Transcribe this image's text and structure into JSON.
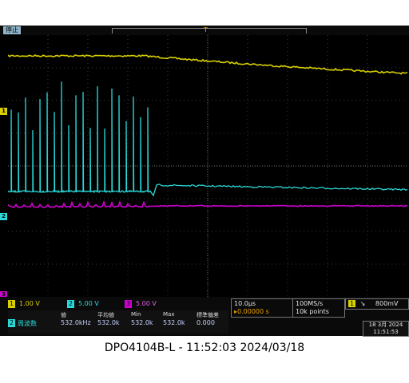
{
  "header": {
    "status": "停止",
    "trigger_marker": "T"
  },
  "channels": {
    "ch1": {
      "num": "1",
      "scale": "1.00 V",
      "color": "#d8d000"
    },
    "ch2": {
      "num": "2",
      "scale": "5.00 V",
      "color": "#2ad8d8"
    },
    "ch3": {
      "num": "3",
      "scale": "5.00 V",
      "color": "#d000d0"
    }
  },
  "timebase": {
    "scale": "10.0µs",
    "position": "▸0.00000 s"
  },
  "acquisition": {
    "rate": "100MS/s",
    "points": "10k points"
  },
  "trigger": {
    "channel": "1",
    "slope": "↘",
    "level": "800mV"
  },
  "measurement": {
    "channel": "2",
    "name": "周波数",
    "headers": [
      "値",
      "平均値",
      "Min",
      "Max",
      "標準偏差"
    ],
    "values": [
      "532.0kHz",
      "532.0k",
      "532.0k",
      "532.0k",
      "0.000"
    ]
  },
  "date": {
    "line1": "18 3月 2024",
    "line2": "11:51:53"
  },
  "caption": "DPO4104B-L - 11:52:03   2024/03/18"
}
